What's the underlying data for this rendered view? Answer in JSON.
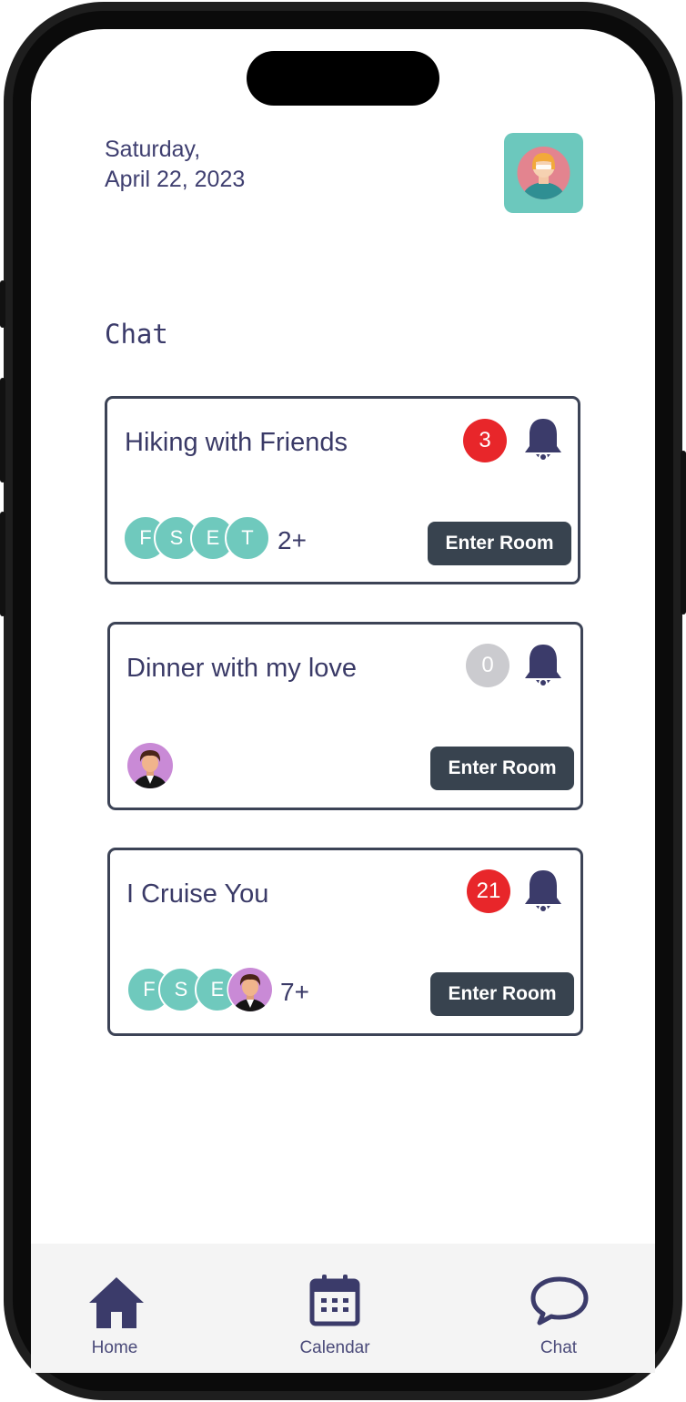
{
  "header": {
    "day": "Saturday,",
    "date": "April 22, 2023"
  },
  "section_title": "Chat",
  "rooms": [
    {
      "title": "Hiking with Friends",
      "unread": "3",
      "members": [
        "F",
        "S",
        "E",
        "T"
      ],
      "more": "2+",
      "button": "Enter Room"
    },
    {
      "title": "Dinner with my love",
      "unread": "0",
      "members": [],
      "more": "",
      "button": "Enter Room"
    },
    {
      "title": "I Cruise You",
      "unread": "21",
      "members": [
        "F",
        "S",
        "E"
      ],
      "more": "7+",
      "button": "Enter Room"
    }
  ],
  "tabs": [
    {
      "label": "Home",
      "icon": "home-icon"
    },
    {
      "label": "Calendar",
      "icon": "calendar-icon"
    },
    {
      "label": "Chat",
      "icon": "chat-icon"
    }
  ],
  "colors": {
    "primary": "#3b3b6a",
    "badge_red": "#e8262a",
    "badge_gray": "#cbcbcf",
    "member_teal": "#6fc9bd",
    "button": "#38434f",
    "profile_tile": "#6cc8bd"
  }
}
